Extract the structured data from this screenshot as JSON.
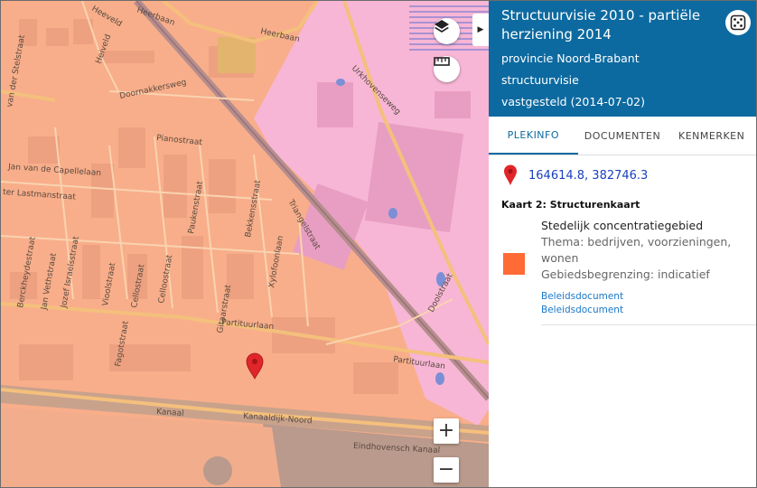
{
  "map": {
    "streets": [
      "Heerbaan",
      "Heeveld",
      "Heerbaan",
      "Heiveld",
      "Doornakkersweg",
      "Pianostraat",
      "Jan van de Capellelaan",
      "ter Lastmanstraat",
      "Urkhovenseweg",
      "Triangelstraat",
      "Bekkensstraat",
      "Paukenstraat",
      "Xylofoonlaan",
      "Cellostraat",
      "Celloostraat",
      "Gitaarstraat",
      "Vioolstraat",
      "Fagotstraat",
      "Jozef Israelsstraat",
      "Jan Vethstraat",
      "Berckheydestraat",
      "Partituurlaan",
      "Partituurlaan",
      "Kanaal",
      "Kanaaldijk-Noord",
      "Eindhovensch Kanaal",
      "Doolstraat",
      "van der Stelstraat"
    ],
    "colors": {
      "zone_salmon": "#f8ae8a",
      "zone_pink": "#f7b6d5",
      "marker": "#e0262a"
    },
    "controls": {
      "zoom_in": "+",
      "zoom_out": "−",
      "collapse": "▶"
    },
    "icons": {
      "layers": "layers-icon",
      "measure": "ruler-icon",
      "marker": "map-marker-icon"
    }
  },
  "panel": {
    "title": "Structuurvisie 2010 - partiële herziening 2014",
    "authority": "provincie Noord-Brabant",
    "plan_type": "structuurvisie",
    "status": "vastgesteld (2014-07-02)",
    "header_color": "#0d6aa0",
    "tabs": [
      {
        "label": "PLEKINFO",
        "active": true
      },
      {
        "label": "DOCUMENTEN",
        "active": false
      },
      {
        "label": "KENMERKEN",
        "active": false
      }
    ],
    "coordinates": "164614.8, 382746.3",
    "map_name": "Kaart 2: Structurenkaart",
    "feature": {
      "name": "Stedelijk concentratiegebied",
      "theme": "Thema: bedrijven, voorzieningen, wonen",
      "boundary": "Gebiedsbegrenzing: indicatief",
      "swatch_color": "#ff6b35",
      "links": [
        "Beleidsdocument",
        "Beleidsdocument"
      ]
    }
  }
}
